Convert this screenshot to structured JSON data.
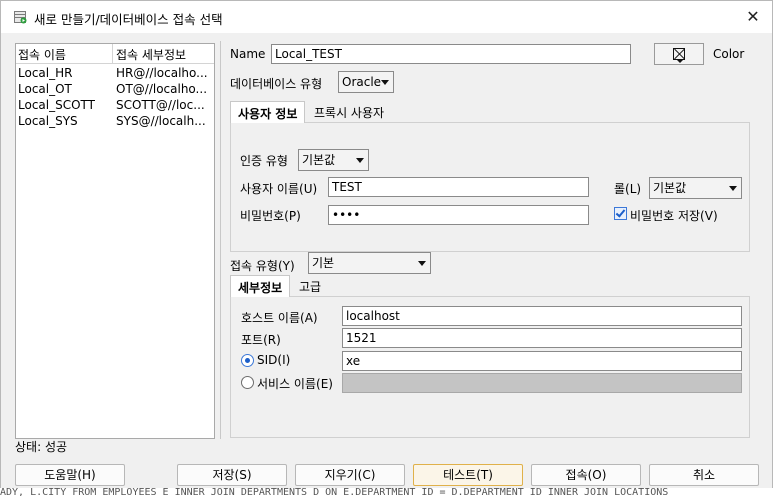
{
  "window": {
    "title": "새로 만들기/데이터베이스 접속 선택",
    "close_label": "✕"
  },
  "connections": {
    "headers": [
      "접속 이름",
      "접속 세부정보"
    ],
    "rows": [
      {
        "name": "Local_HR",
        "detail": "HR@//localho..."
      },
      {
        "name": "Local_OT",
        "detail": "OT@//localho..."
      },
      {
        "name": "Local_SCOTT",
        "detail": "SCOTT@//loc..."
      },
      {
        "name": "Local_SYS",
        "detail": "SYS@//localh..."
      }
    ]
  },
  "status": "상태: 성공",
  "form": {
    "name_label": "Name",
    "name_value": "Local_TEST",
    "color_label": "Color",
    "db_type_label": "데이터베이스 유형",
    "db_type_value": "Oracle",
    "tabs": [
      "사용자 정보",
      "프록시 사용자"
    ],
    "auth_type_label": "인증 유형",
    "auth_type_value": "기본값",
    "username_label": "사용자 이름(U)",
    "username_value": "TEST",
    "role_label": "롤(L)",
    "role_value": "기본값",
    "password_label": "비밀번호(P)",
    "password_value": "••••",
    "save_password_label": "비밀번호 저장(V)",
    "save_password_checked": true,
    "conn_type_label": "접속 유형(Y)",
    "conn_type_value": "기본",
    "detail_tabs": [
      "세부정보",
      "고급"
    ],
    "host_label": "호스트 이름(A)",
    "host_value": "localhost",
    "port_label": "포트(R)",
    "port_value": "1521",
    "sid_label": "SID(I)",
    "sid_value": "xe",
    "service_label": "서비스 이름(E)",
    "service_value": ""
  },
  "buttons": {
    "help": "도움말(H)",
    "save": "저장(S)",
    "clear": "지우기(C)",
    "test": "테스트(T)",
    "connect": "접속(O)",
    "cancel": "취소"
  },
  "background_text": "ADY, L.CITY FROM EMPLOYEES E INNER JOIN DEPARTMENTS D ON E.DEPARTMENT_ID = D.DEPARTMENT_ID INNER JOIN LOCATIONS"
}
